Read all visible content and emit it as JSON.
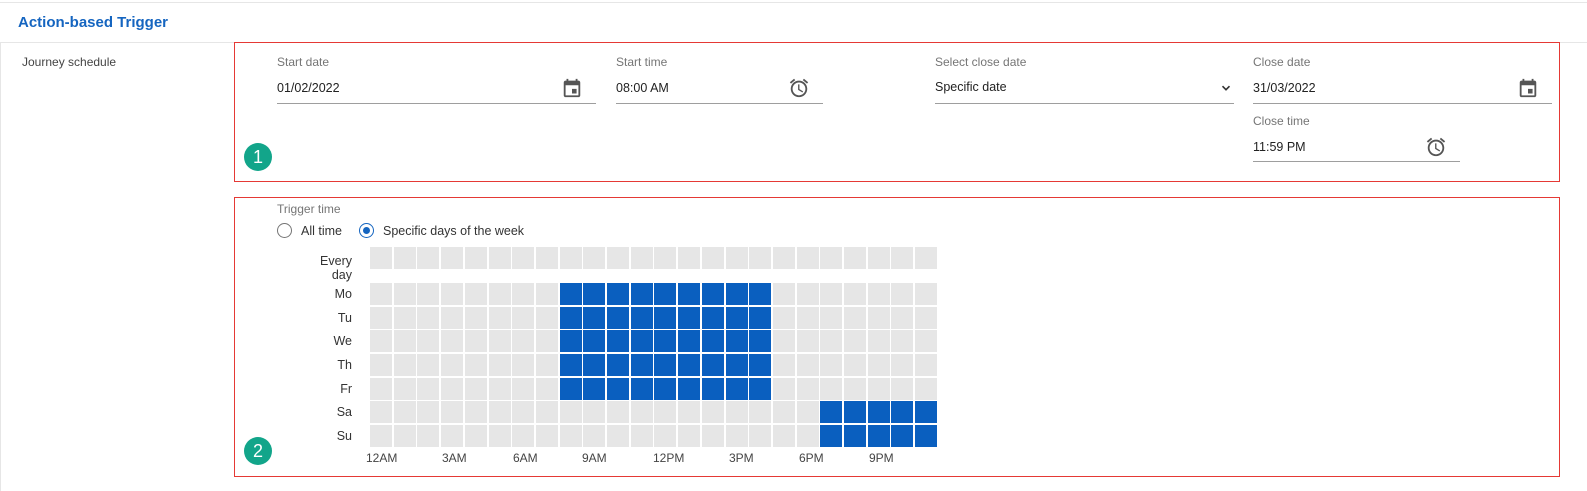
{
  "header": {
    "title": "Action-based Trigger"
  },
  "row": {
    "label": "Journey schedule"
  },
  "schedule": {
    "start_date": {
      "label": "Start date",
      "value": "01/02/2022",
      "icon": "calendar-icon"
    },
    "start_time": {
      "label": "Start time",
      "value": "08:00 AM",
      "icon": "alarm-clock-icon"
    },
    "select_close_date": {
      "label": "Select close date",
      "value": "Specific date",
      "icon": "chevron-down-icon"
    },
    "close_date": {
      "label": "Close date",
      "value": "31/03/2022",
      "icon": "calendar-icon"
    },
    "close_time": {
      "label": "Close time",
      "value": "11:59 PM",
      "icon": "alarm-clock-icon"
    }
  },
  "badges": {
    "one": "1",
    "two": "2"
  },
  "trigger": {
    "label": "Trigger time",
    "options": [
      {
        "label": "All time",
        "checked": false
      },
      {
        "label": "Specific days of the week",
        "checked": true
      }
    ]
  },
  "grid": {
    "every_day_label": "Every day",
    "days": [
      "Mo",
      "Tu",
      "We",
      "Th",
      "Fr",
      "Sa",
      "Su"
    ],
    "hour_labels": [
      "12AM",
      "3AM",
      "6AM",
      "9AM",
      "12PM",
      "3PM",
      "6PM",
      "9PM"
    ],
    "active_color": "#0a5fbf",
    "inactive_color": "#e6e6e6",
    "selected_hours": {
      "Mo": [
        8,
        9,
        10,
        11,
        12,
        13,
        14,
        15,
        16
      ],
      "Tu": [
        8,
        9,
        10,
        11,
        12,
        13,
        14,
        15,
        16
      ],
      "We": [
        8,
        9,
        10,
        11,
        12,
        13,
        14,
        15,
        16
      ],
      "Th": [
        8,
        9,
        10,
        11,
        12,
        13,
        14,
        15,
        16
      ],
      "Fr": [
        8,
        9,
        10,
        11,
        12,
        13,
        14,
        15,
        16
      ],
      "Sa": [
        19,
        20,
        21,
        22,
        23
      ],
      "Su": [
        19,
        20,
        21,
        22,
        23
      ]
    }
  }
}
